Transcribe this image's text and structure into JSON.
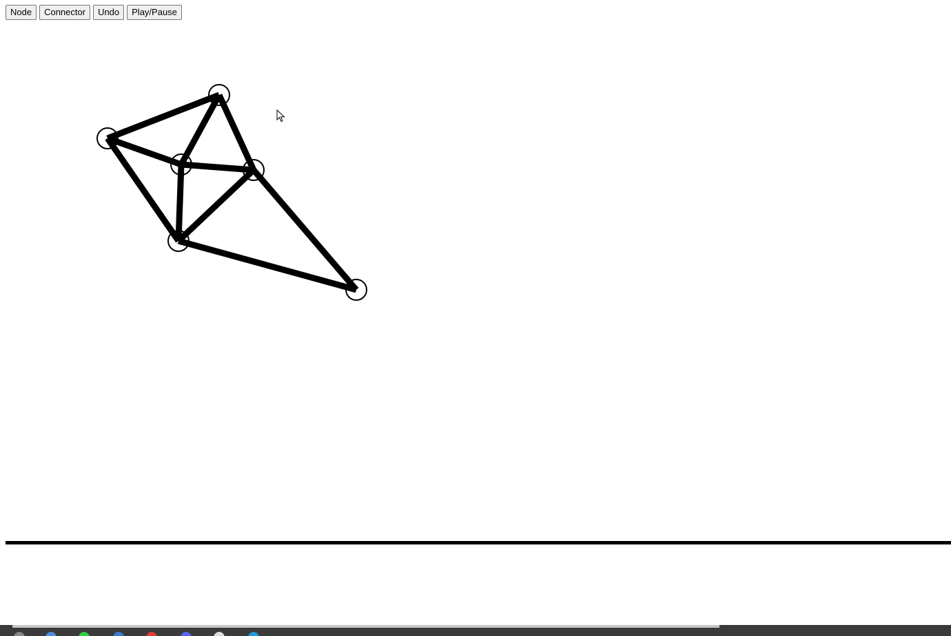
{
  "toolbar": {
    "buttons": [
      {
        "id": "node",
        "label": "Node"
      },
      {
        "id": "connector",
        "label": "Connector"
      },
      {
        "id": "undo",
        "label": "Undo"
      },
      {
        "id": "play_pause",
        "label": "Play/Pause"
      }
    ]
  },
  "graph": {
    "nodes": [
      {
        "id": "n1"
      },
      {
        "id": "n2"
      },
      {
        "id": "n3"
      },
      {
        "id": "n4"
      },
      {
        "id": "n5"
      },
      {
        "id": "n6"
      }
    ],
    "edges": [
      {
        "from": "n1",
        "to": "n2"
      },
      {
        "from": "n2",
        "to": "n3"
      },
      {
        "from": "n2",
        "to": "n4"
      },
      {
        "from": "n1",
        "to": "n3"
      },
      {
        "from": "n1",
        "to": "n5"
      },
      {
        "from": "n3",
        "to": "n4"
      },
      {
        "from": "n3",
        "to": "n5"
      },
      {
        "from": "n4",
        "to": "n5"
      },
      {
        "from": "n4",
        "to": "n6"
      },
      {
        "from": "n5",
        "to": "n6"
      }
    ],
    "colors": {
      "edge": "#000000",
      "node_stroke": "#000000",
      "node_fill": "transparent",
      "ground": "#000000"
    }
  },
  "taskbar": {
    "icons": [
      "file-explorer-icon",
      "chrome-icon",
      "store-icon",
      "opera-icon",
      "discord-icon",
      "mail-icon",
      "edge-icon",
      "app-icon"
    ]
  }
}
